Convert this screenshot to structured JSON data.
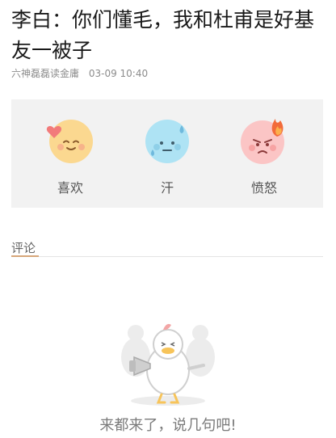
{
  "article": {
    "title": "李白：你们懂毛，我和杜甫是好基友一被子",
    "author": "六神磊磊读金庸",
    "date": "03-09 10:40"
  },
  "reactions": [
    {
      "label": "喜欢",
      "icon": "heart-face-icon",
      "color": "#fbd890"
    },
    {
      "label": "汗",
      "icon": "sweat-face-icon",
      "color": "#aee3f4"
    },
    {
      "label": "愤怒",
      "icon": "angry-face-icon",
      "color": "#fbc5c5"
    }
  ],
  "comments": {
    "tab_label": "评论",
    "empty_text": "来都来了，说几句吧!"
  }
}
